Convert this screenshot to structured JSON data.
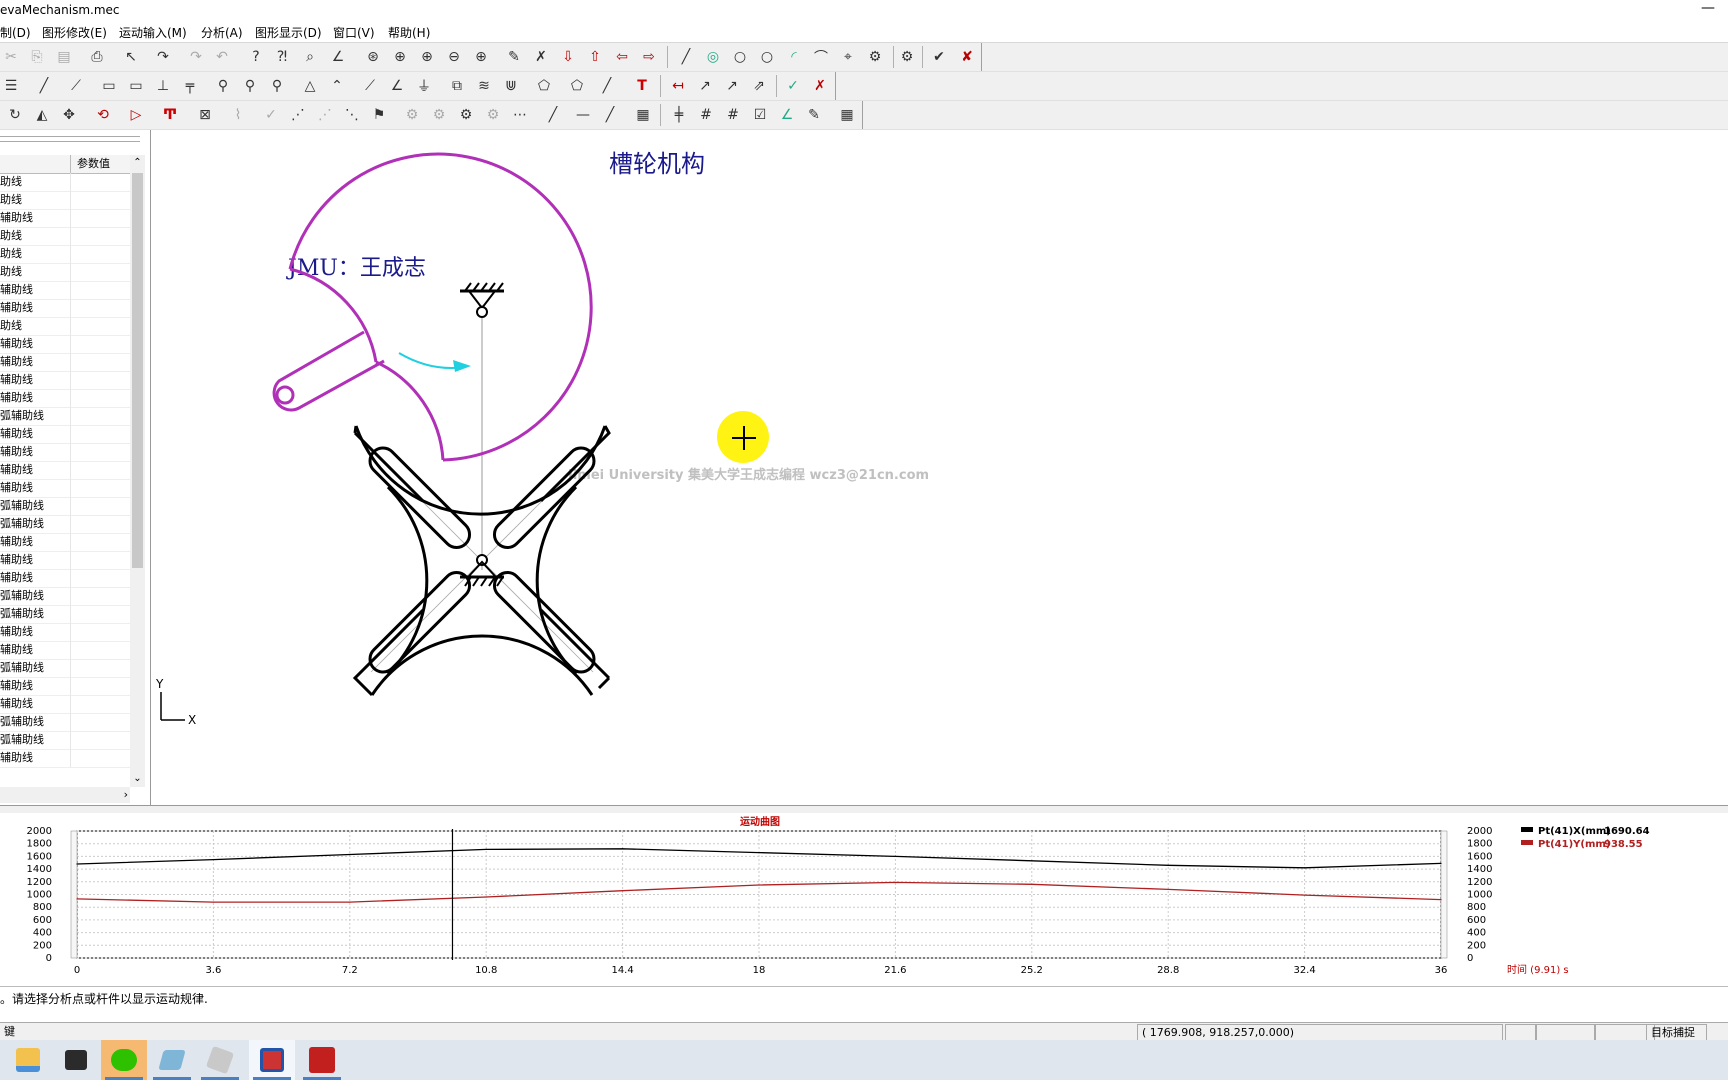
{
  "window": {
    "title": "evaMechanism.mec",
    "minimize": "—"
  },
  "menu": [
    "制(D)",
    "图形修改(E)",
    "运动输入(M)",
    "分析(A)",
    "图形显示(D)",
    "窗口(V)",
    "帮助(H)"
  ],
  "param_panel": {
    "header_value": "参数值",
    "rows": [
      "助线",
      "助线",
      "辅助线",
      "助线",
      "助线",
      "助线",
      "辅助线",
      "辅助线",
      "助线",
      "辅助线",
      "辅助线",
      "辅助线",
      "辅助线",
      "弧辅助线",
      "辅助线",
      "辅助线",
      "辅助线",
      "辅助线",
      "弧辅助线",
      "弧辅助线",
      "辅助线",
      "辅助线",
      "辅助线",
      "弧辅助线",
      "弧辅助线",
      "辅助线",
      "辅助线",
      "弧辅助线",
      "辅助线",
      "辅助线",
      "弧辅助线",
      "弧辅助线",
      "辅助线"
    ]
  },
  "canvas": {
    "title": "槽轮机构",
    "author": "JMU：王成志",
    "watermark": "Jimei University 集美大学王成志编程  wcz3@21cn.com",
    "axis_y": "Y",
    "axis_x": "X",
    "colors": {
      "crank": "#b030b8",
      "wheel": "#000000",
      "arrow": "#20d0e0",
      "text": "#1a1a8c",
      "cursor": "#fff200"
    }
  },
  "motion_chart": {
    "title": "运动曲图",
    "left_ticks": [
      "2000",
      "1800",
      "1600",
      "1400",
      "1200",
      "1000",
      "800",
      "600",
      "400",
      "200",
      "0"
    ],
    "right_ticks": [
      "2000",
      "1800",
      "1600",
      "1400",
      "1200",
      "1000",
      "800",
      "600",
      "400",
      "200",
      "0"
    ],
    "x_ticks": [
      "0",
      "3.6",
      "7.2",
      "10.8",
      "14.4",
      "18",
      "21.6",
      "25.2",
      "28.8",
      "32.4",
      "36"
    ],
    "time_label": "时间 (9.91) s",
    "legend": [
      {
        "name": "Pt(41)X(mm)",
        "value": "1690.64",
        "color": "#000000"
      },
      {
        "name": "Pt(41)Y(mm)",
        "value": "938.55",
        "color": "#b02020"
      }
    ]
  },
  "chart_data": {
    "type": "line",
    "title": "运动曲图",
    "xlabel": "时间 (9.91) s",
    "ylabel": "",
    "xlim": [
      0,
      36
    ],
    "ylim": [
      0,
      2000
    ],
    "grid": true,
    "legend_position": "right",
    "cursor_x": 9.91,
    "x": [
      0,
      3.6,
      7.2,
      10.8,
      14.4,
      18,
      21.6,
      25.2,
      28.8,
      32.4,
      36
    ],
    "series": [
      {
        "name": "Pt(41)X(mm)",
        "color": "#000000",
        "values": [
          1480,
          1550,
          1630,
          1710,
          1720,
          1660,
          1600,
          1530,
          1460,
          1420,
          1490
        ]
      },
      {
        "name": "Pt(41)Y(mm)",
        "color": "#b02020",
        "values": [
          930,
          880,
          880,
          960,
          1060,
          1150,
          1190,
          1160,
          1080,
          990,
          920
        ]
      }
    ]
  },
  "status": {
    "message": "。请选择分析点或杆件以显示运动规律.",
    "left": "键",
    "coords": "(   1769.908,    918.257,0.000)",
    "snap": "目标捕捉"
  }
}
